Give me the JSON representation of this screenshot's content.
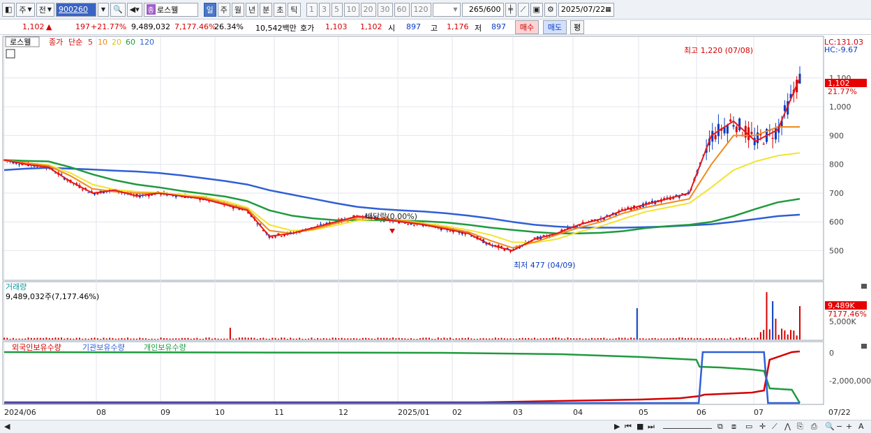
{
  "toolbar": {
    "period_main": "주",
    "prev_label": "전",
    "code": "900260",
    "name_badge": "종",
    "name": "로스웰",
    "periods": [
      "일",
      "주",
      "월",
      "년",
      "분",
      "초",
      "틱"
    ],
    "active_period": "일",
    "intervals": [
      "1",
      "3",
      "5",
      "10",
      "20",
      "30",
      "60",
      "120"
    ],
    "count": "265",
    "count_max": "/600",
    "date": "2025/07/22"
  },
  "quote": {
    "price": "1,102",
    "arrow": "▲",
    "change": "197",
    "change_pct": "+21.77%",
    "volume": "9,489,032",
    "volume_pct": "7,177.46%",
    "turnover": "26.34%",
    "amount": "10,542백만",
    "hoga_label": "호가",
    "ask": "1,103",
    "bid": "1,102",
    "open_label": "시",
    "open": "897",
    "high_label": "고",
    "high": "1,176",
    "low_label": "저",
    "low": "897",
    "buy_label": "매수",
    "sell_label": "매도",
    "avg_label": "평"
  },
  "indicators": {
    "name_tag": "로스웰",
    "close_label": "종가",
    "simple_label": "단순",
    "ma5": "5",
    "ma10": "10",
    "ma20": "20",
    "ma60": "60",
    "ma120": "120",
    "lc": "LC:131.03",
    "hc": "HC:-9.67",
    "volume_title": "거래량",
    "volume_value": "9,489,032주(7,177.46%)",
    "holdings_foreign": "외국인보유수량",
    "holdings_inst": "기관보유수량",
    "holdings_indiv": "개인보유수량"
  },
  "colors": {
    "up": "#d40000",
    "down": "#0a3cc2",
    "ma5": "#e8161b",
    "ma10": "#ef8a1c",
    "ma20": "#f2e32c",
    "ma60": "#1f9a3e",
    "ma120": "#2f5fd6",
    "accent": "#4a77c9"
  },
  "chart_data": {
    "type": "line",
    "title": "",
    "price_axis": {
      "ticks": [
        500,
        600,
        700,
        800,
        900,
        1000,
        1100
      ],
      "tick_labels": [
        "500",
        "600",
        "700",
        "800",
        "900",
        "1,000",
        "1,100"
      ],
      "ylim": [
        402,
        1240
      ]
    },
    "x_labels": [
      "2024/06",
      "08",
      "09",
      "10",
      "11",
      "12",
      "2025/01",
      "02",
      "03",
      "04",
      "05",
      "06",
      "07",
      "07/22"
    ],
    "annotations": {
      "high": "최고 1,220 (07/08)",
      "low": "최저 477 (04/09)",
      "dividend": "배당락(0.00%)",
      "last_price": "1,102",
      "last_pct": "21.77%"
    },
    "series": [
      {
        "name": "5",
        "values": [
          815,
          800,
          790,
          740,
          700,
          710,
          690,
          700,
          690,
          680,
          660,
          640,
          550,
          560,
          580,
          600,
          620,
          610,
          600,
          590,
          575,
          560,
          520,
          500,
          540,
          560,
          590,
          610,
          640,
          660,
          680,
          700,
          900,
          950,
          880,
          920,
          1100
        ]
      },
      {
        "name": "10",
        "values": [
          815,
          805,
          795,
          760,
          715,
          705,
          700,
          700,
          690,
          685,
          665,
          645,
          570,
          560,
          575,
          595,
          615,
          612,
          605,
          592,
          580,
          565,
          535,
          510,
          530,
          555,
          580,
          600,
          630,
          650,
          665,
          680,
          800,
          900,
          900,
          930,
          930
        ]
      },
      {
        "name": "20",
        "values": [
          812,
          805,
          798,
          770,
          730,
          712,
          705,
          702,
          695,
          688,
          672,
          650,
          590,
          570,
          572,
          588,
          605,
          610,
          606,
          595,
          585,
          572,
          555,
          530,
          528,
          540,
          565,
          585,
          610,
          635,
          650,
          665,
          720,
          780,
          810,
          830,
          840
        ]
      },
      {
        "name": "60",
        "values": [
          815,
          812,
          810,
          790,
          765,
          745,
          730,
          720,
          708,
          698,
          688,
          672,
          640,
          622,
          612,
          606,
          606,
          606,
          605,
          602,
          598,
          590,
          580,
          572,
          565,
          560,
          560,
          562,
          568,
          578,
          585,
          590,
          600,
          620,
          645,
          668,
          680
        ]
      },
      {
        "name": "120",
        "values": [
          780,
          785,
          788,
          785,
          782,
          778,
          775,
          770,
          762,
          752,
          742,
          730,
          710,
          695,
          680,
          665,
          652,
          645,
          640,
          636,
          630,
          622,
          612,
          600,
          590,
          584,
          580,
          580,
          580,
          582,
          584,
          588,
          592,
          600,
          610,
          620,
          625
        ]
      }
    ],
    "volume_axis": {
      "tick_labels": [
        "5,000K"
      ],
      "last_label": "9,489K",
      "last_pct": "7177.46%"
    },
    "holdings_axis": {
      "tick_labels": [
        "0",
        "-2,000,000"
      ]
    }
  },
  "scroll": {
    "date_label": "07/22"
  }
}
